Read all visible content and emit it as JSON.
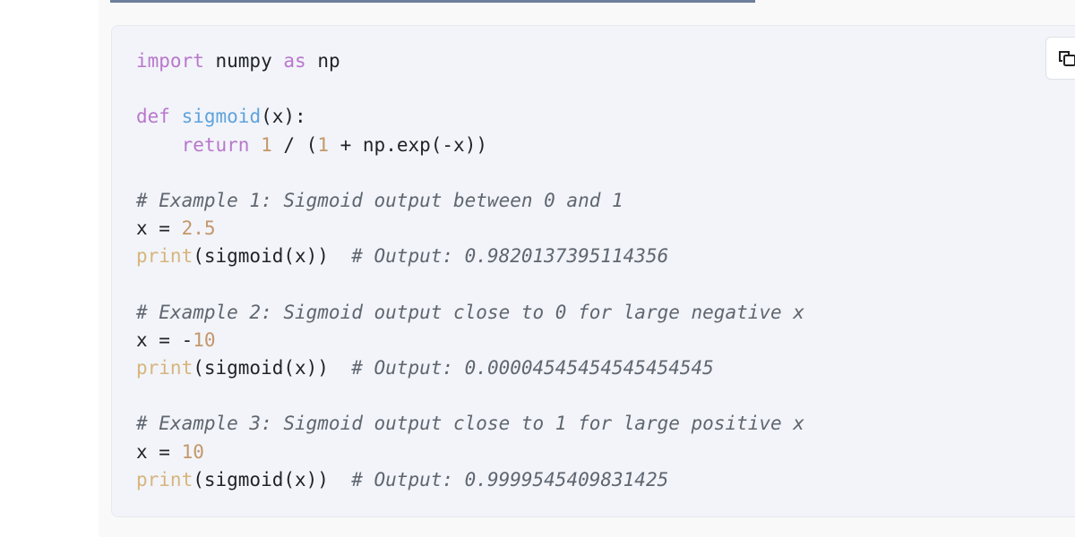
{
  "code": {
    "language": "python",
    "lines": [
      [
        [
          "kw",
          "import"
        ],
        [
          "t",
          " numpy "
        ],
        [
          "kw",
          "as"
        ],
        [
          "t",
          " np"
        ]
      ],
      [],
      [
        [
          "kw",
          "def"
        ],
        [
          "t",
          " "
        ],
        [
          "fn",
          "sigmoid"
        ],
        [
          "t",
          "(x):"
        ]
      ],
      [
        [
          "t",
          "    "
        ],
        [
          "kw",
          "return"
        ],
        [
          "t",
          " "
        ],
        [
          "num",
          "1"
        ],
        [
          "t",
          " / ("
        ],
        [
          "num",
          "1"
        ],
        [
          "t",
          " + np.exp(-x))"
        ]
      ],
      [],
      [
        [
          "cm",
          "# Example 1: Sigmoid output between 0 and 1"
        ]
      ],
      [
        [
          "t",
          "x = "
        ],
        [
          "num",
          "2.5"
        ]
      ],
      [
        [
          "bi",
          "print"
        ],
        [
          "t",
          "(sigmoid(x))  "
        ],
        [
          "cm",
          "# Output: 0.9820137395114356"
        ]
      ],
      [],
      [
        [
          "cm",
          "# Example 2: Sigmoid output close to 0 for large negative x"
        ]
      ],
      [
        [
          "t",
          "x = -"
        ],
        [
          "num",
          "10"
        ]
      ],
      [
        [
          "bi",
          "print"
        ],
        [
          "t",
          "(sigmoid(x))  "
        ],
        [
          "cm",
          "# Output: 0.00004545454545454545"
        ]
      ],
      [],
      [
        [
          "cm",
          "# Example 3: Sigmoid output close to 1 for large positive x"
        ]
      ],
      [
        [
          "t",
          "x = "
        ],
        [
          "num",
          "10"
        ]
      ],
      [
        [
          "bi",
          "print"
        ],
        [
          "t",
          "(sigmoid(x))  "
        ],
        [
          "cm",
          "# Output: 0.9999545409831425"
        ]
      ]
    ]
  },
  "copy_button": {
    "icon": "copy-icon"
  },
  "colors": {
    "keyword": "#b977cc",
    "function": "#5fa3dd",
    "number": "#c4976a",
    "builtin": "#d6b57c",
    "comment": "#5f6670",
    "background": "#f2f4f9"
  }
}
